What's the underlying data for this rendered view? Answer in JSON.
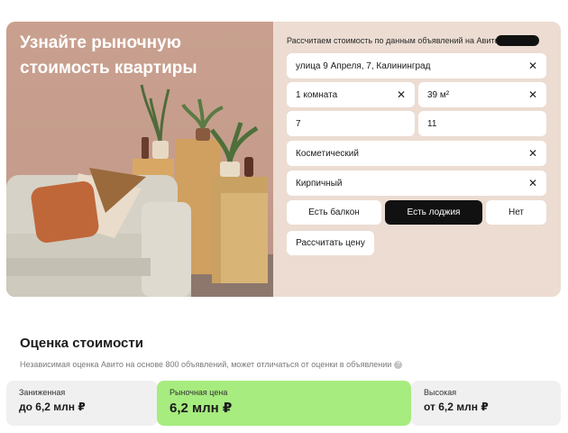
{
  "hero": {
    "title": "Узнайте рыночную стоимость квартиры"
  },
  "form": {
    "caption": "Рассчитаем стоимость по данным объявлений на Авито",
    "address": {
      "value": "улица 9 Апреля, 7, Калининград"
    },
    "rooms": {
      "value": "1 комната"
    },
    "area": {
      "value": "39 м²"
    },
    "floor": {
      "value": "7"
    },
    "floors_total": {
      "value": "11"
    },
    "renovation": {
      "value": "Косметический"
    },
    "material": {
      "value": "Кирпичный"
    },
    "balcony_options": [
      "Есть балкон",
      "Есть лоджия",
      "Нет"
    ],
    "balcony_selected": "Есть лоджия",
    "submit_label": "Рассчитать цену"
  },
  "estimate": {
    "title": "Оценка стоимости",
    "subtitle": "Независимая оценка Авито на основе 800 объявлений, может отличаться от оценки в объявлении",
    "low": {
      "label": "Заниженная",
      "value": "до 6,2 млн ₽"
    },
    "market": {
      "label": "Рыночная цена",
      "value": "6,2 млн ₽"
    },
    "high": {
      "label": "Высокая",
      "value": "от 6,2 млн ₽"
    }
  },
  "colors": {
    "accent_green": "#a7ec7f",
    "active_segment": "#111111",
    "card_bg": "#ecdcd2"
  }
}
